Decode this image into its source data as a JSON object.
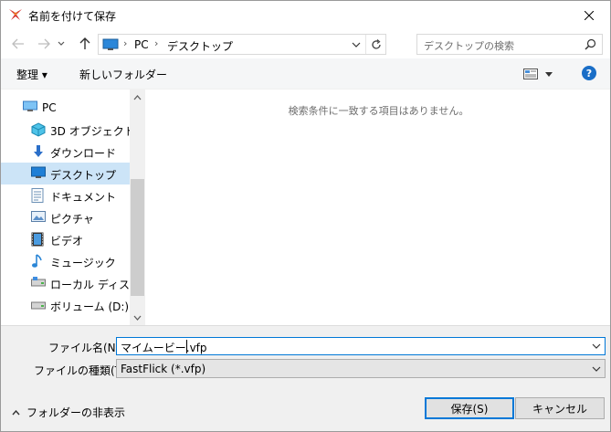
{
  "window": {
    "title": "名前を付けて保存"
  },
  "address": {
    "crumbs": [
      "PC",
      "デスクトップ"
    ]
  },
  "search": {
    "placeholder": "デスクトップの検索"
  },
  "toolbar": {
    "organize_label": "整理 ▾",
    "new_folder_label": "新しいフォルダー",
    "help_label": "?"
  },
  "nav": {
    "items": [
      {
        "label": "PC",
        "icon": "pc-icon"
      },
      {
        "label": "3D オブジェクト",
        "icon": "3d-objects-icon"
      },
      {
        "label": "ダウンロード",
        "icon": "download-icon"
      },
      {
        "label": "デスクトップ",
        "icon": "desktop-icon",
        "selected": true
      },
      {
        "label": "ドキュメント",
        "icon": "document-icon"
      },
      {
        "label": "ピクチャ",
        "icon": "pictures-icon"
      },
      {
        "label": "ビデオ",
        "icon": "video-icon"
      },
      {
        "label": "ミュージック",
        "icon": "music-icon"
      },
      {
        "label": "ローカル ディスク (C",
        "icon": "disk-icon"
      },
      {
        "label": "ボリューム (D:)",
        "icon": "volume-icon"
      }
    ]
  },
  "content": {
    "empty_message": "検索条件に一致する項目はありません。"
  },
  "form": {
    "filename_label": "ファイル名(N):",
    "filename_value": "マイムービー.vfp",
    "filetype_label": "ファイルの種類(T):",
    "filetype_value": "FastFlick (*.vfp)",
    "hide_folders_label": "フォルダーの非表示",
    "save_label": "保存(S)",
    "cancel_label": "キャンセル"
  },
  "colors": {
    "selection": "#cce4f7",
    "accent": "#0078d7",
    "help_bg": "#1a6ec7"
  }
}
